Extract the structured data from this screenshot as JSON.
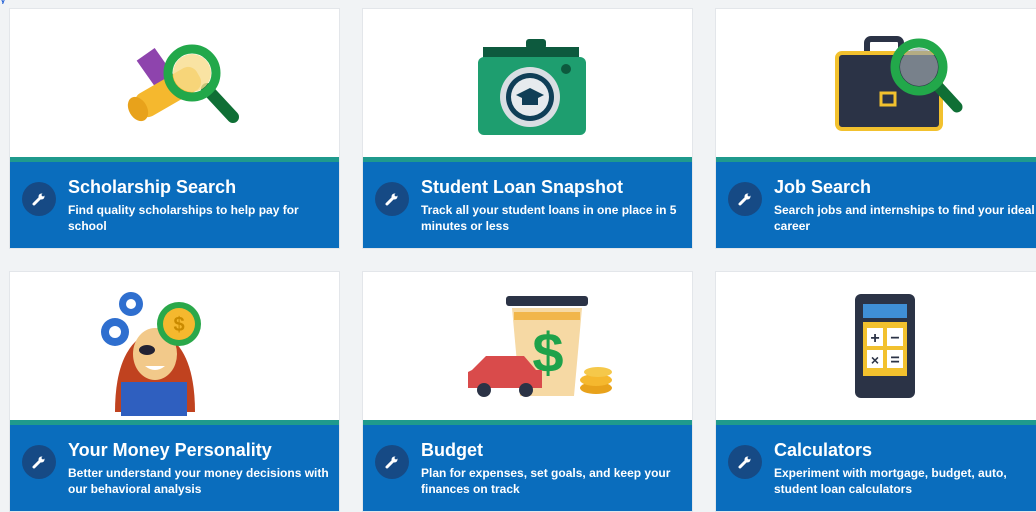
{
  "header": {
    "link_fragment": "y"
  },
  "colors": {
    "band": "#0a6dbd",
    "stripe": "#1f9a8d",
    "tool_button": "#164a85"
  },
  "cards": [
    {
      "title": "Scholarship Search",
      "description": "Find quality scholarships to help pay for school",
      "icon": "scholarship-magnifier-icon"
    },
    {
      "title": "Student Loan Snapshot",
      "description": "Track all your student loans in one place in 5 minutes or less",
      "icon": "camera-graduation-icon"
    },
    {
      "title": "Job Search",
      "description": "Search jobs and internships to find your ideal career",
      "icon": "briefcase-magnifier-icon"
    },
    {
      "title": "Your Money Personality",
      "description": "Better understand your money decisions with our behavioral analysis",
      "icon": "person-gears-icon"
    },
    {
      "title": "Budget",
      "description": "Plan for expenses, set goals, and keep your finances on track",
      "icon": "coffee-car-dollar-icon"
    },
    {
      "title": "Calculators",
      "description": "Experiment with mortgage, budget, auto, student loan calculators",
      "icon": "calculator-icon"
    }
  ]
}
